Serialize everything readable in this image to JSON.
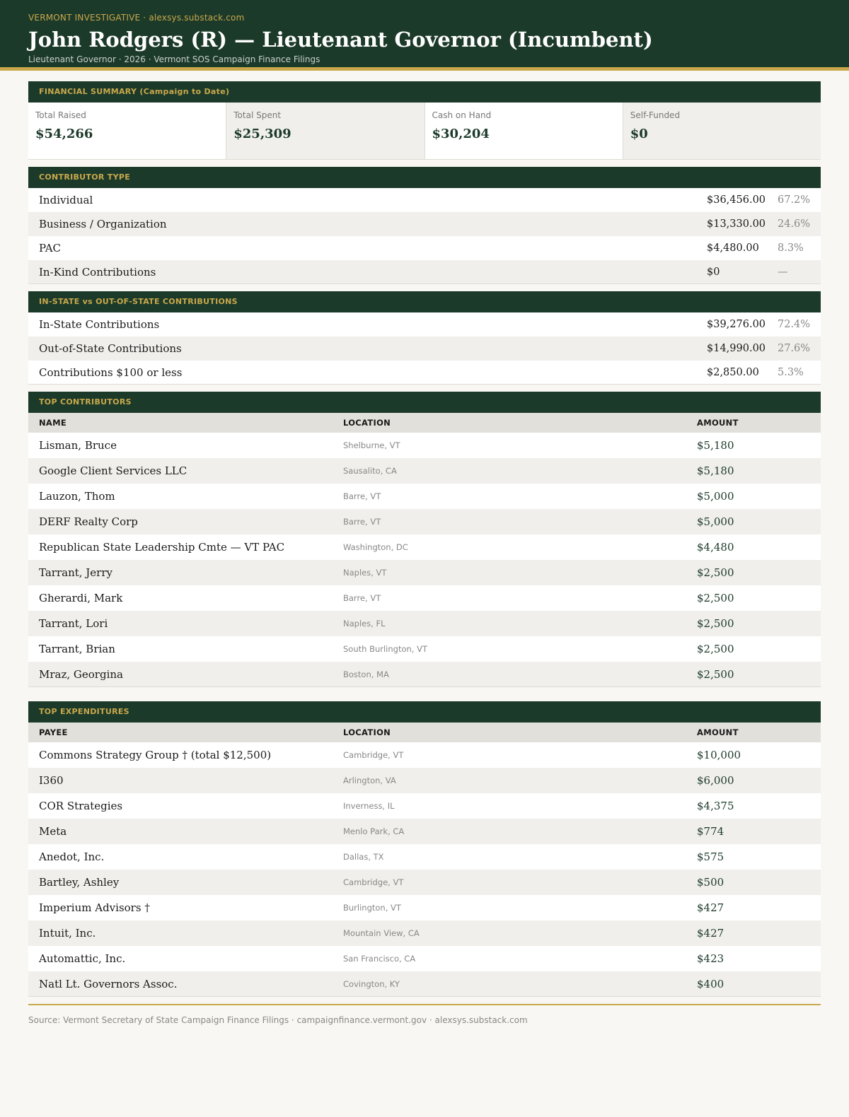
{
  "header": {
    "kicker": "VERMONT INVESTIGATIVE · alexsys.substack.com",
    "title": "John Rodgers (R) — Lieutenant Governor (Incumbent)",
    "subtitle": "Lieutenant Governor · 2026 · Vermont SOS Campaign Finance Filings"
  },
  "summary": {
    "heading": "FINANCIAL SUMMARY (Campaign to Date)",
    "cells": [
      {
        "label": "Total Raised",
        "value": "$54,266"
      },
      {
        "label": "Total Spent",
        "value": "$25,309"
      },
      {
        "label": "Cash on Hand",
        "value": "$30,204"
      },
      {
        "label": "Self-Funded",
        "value": "$0"
      }
    ]
  },
  "contributor_type": {
    "heading": "CONTRIBUTOR TYPE",
    "rows": [
      {
        "label": "Individual",
        "amount": "$36,456.00",
        "pct": "67.2%"
      },
      {
        "label": "Business / Organization",
        "amount": "$13,330.00",
        "pct": "24.6%"
      },
      {
        "label": "PAC",
        "amount": "$4,480.00",
        "pct": "8.3%"
      },
      {
        "label": "In-Kind Contributions",
        "amount": "$0",
        "pct": "—"
      }
    ]
  },
  "in_out_state": {
    "heading": "IN-STATE vs OUT-OF-STATE CONTRIBUTIONS",
    "rows": [
      {
        "label": "In-State Contributions",
        "amount": "$39,276.00",
        "pct": "72.4%"
      },
      {
        "label": "Out-of-State Contributions",
        "amount": "$14,990.00",
        "pct": "27.6%"
      },
      {
        "label": "Contributions $100 or less",
        "amount": "$2,850.00",
        "pct": "5.3%"
      }
    ]
  },
  "top_contributors": {
    "heading": "TOP CONTRIBUTORS",
    "columns": [
      "NAME",
      "LOCATION",
      "AMOUNT"
    ],
    "rows": [
      {
        "name": "Lisman, Bruce",
        "location": "Shelburne, VT",
        "amount": "$5,180"
      },
      {
        "name": "Google Client Services LLC",
        "location": "Sausalito, CA",
        "amount": "$5,180"
      },
      {
        "name": "Lauzon, Thom",
        "location": "Barre, VT",
        "amount": "$5,000"
      },
      {
        "name": "DERF Realty Corp",
        "location": "Barre, VT",
        "amount": "$5,000"
      },
      {
        "name": "Republican State Leadership Cmte — VT PAC",
        "location": "Washington, DC",
        "amount": "$4,480"
      },
      {
        "name": "Tarrant, Jerry",
        "location": "Naples, VT",
        "amount": "$2,500"
      },
      {
        "name": "Gherardi, Mark",
        "location": "Barre, VT",
        "amount": "$2,500"
      },
      {
        "name": "Tarrant, Lori",
        "location": "Naples, FL",
        "amount": "$2,500"
      },
      {
        "name": "Tarrant, Brian",
        "location": "South Burlington, VT",
        "amount": "$2,500"
      },
      {
        "name": "Mraz, Georgina",
        "location": "Boston, MA",
        "amount": "$2,500"
      }
    ]
  },
  "top_expenditures": {
    "heading": "TOP EXPENDITURES",
    "columns": [
      "PAYEE",
      "LOCATION",
      "AMOUNT"
    ],
    "rows": [
      {
        "name": "Commons Strategy Group † (total $12,500)",
        "location": "Cambridge, VT",
        "amount": "$10,000"
      },
      {
        "name": "I360",
        "location": "Arlington, VA",
        "amount": "$6,000"
      },
      {
        "name": "COR Strategies",
        "location": "Inverness, IL",
        "amount": "$4,375"
      },
      {
        "name": "Meta",
        "location": "Menlo Park, CA",
        "amount": "$774"
      },
      {
        "name": "Anedot, Inc.",
        "location": "Dallas, TX",
        "amount": "$575"
      },
      {
        "name": "Bartley, Ashley",
        "location": "Cambridge, VT",
        "amount": "$500"
      },
      {
        "name": "Imperium Advisors †",
        "location": "Burlington, VT",
        "amount": "$427"
      },
      {
        "name": "Intuit, Inc.",
        "location": "Mountain View, CA",
        "amount": "$427"
      },
      {
        "name": "Automattic, Inc.",
        "location": "San Francisco, CA",
        "amount": "$423"
      },
      {
        "name": "Natl Lt. Governors Assoc.",
        "location": "Covington, KY",
        "amount": "$400"
      }
    ]
  },
  "footer": {
    "source": "Source: Vermont Secretary of State Campaign Finance Filings · campaignfinance.vermont.gov · alexsys.substack.com"
  }
}
